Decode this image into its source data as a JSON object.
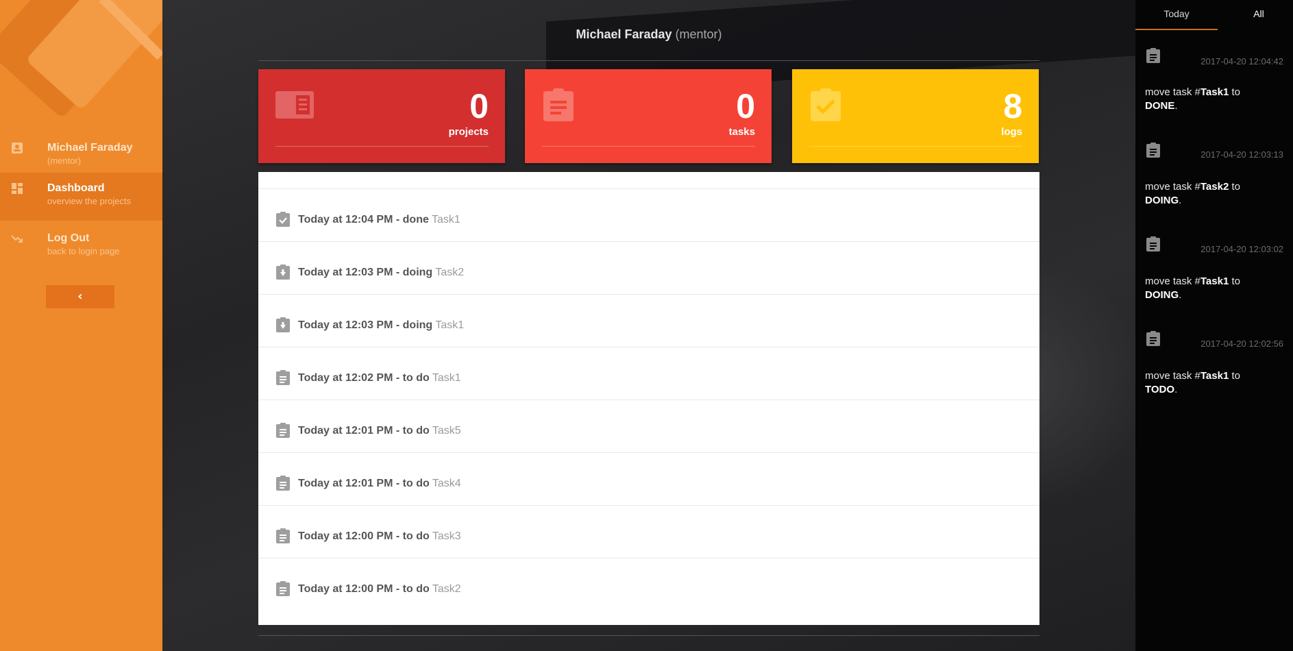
{
  "sidebar": {
    "user": {
      "name": "Michael Faraday",
      "role": "(mentor)"
    },
    "items": [
      {
        "title": "Dashboard",
        "subtitle": "overview the projects"
      },
      {
        "title": "Log Out",
        "subtitle": "back to login page"
      }
    ],
    "collapse_label": "‹"
  },
  "header": {
    "user_name": "Michael Faraday",
    "role": "(mentor)"
  },
  "cards": [
    {
      "count": "0",
      "label": "projects",
      "color": "#d32f2f",
      "icon": "projects-icon"
    },
    {
      "count": "0",
      "label": "tasks",
      "color": "#f44336",
      "icon": "clipboard-icon"
    },
    {
      "count": "8",
      "label": "logs",
      "color": "#ffc107",
      "icon": "clipboard-check-icon"
    }
  ],
  "logs": [
    {
      "when": "Today at 12:04 PM - ",
      "action": "done",
      "task": "Task1",
      "icon": "clipboard-check-icon"
    },
    {
      "when": "Today at 12:03 PM - ",
      "action": "doing",
      "task": "Task2",
      "icon": "clipboard-down-icon"
    },
    {
      "when": "Today at 12:03 PM - ",
      "action": "doing",
      "task": "Task1",
      "icon": "clipboard-down-icon"
    },
    {
      "when": "Today at 12:02 PM - ",
      "action": "to do",
      "task": "Task1",
      "icon": "clipboard-icon"
    },
    {
      "when": "Today at 12:01 PM - ",
      "action": "to do",
      "task": "Task5",
      "icon": "clipboard-icon"
    },
    {
      "when": "Today at 12:01 PM - ",
      "action": "to do",
      "task": "Task4",
      "icon": "clipboard-icon"
    },
    {
      "when": "Today at 12:00 PM - ",
      "action": "to do",
      "task": "Task3",
      "icon": "clipboard-icon"
    },
    {
      "when": "Today at 12:00 PM - ",
      "action": "to do",
      "task": "Task2",
      "icon": "clipboard-icon"
    }
  ],
  "right_panel": {
    "tabs": [
      "Today",
      "All"
    ],
    "active_tab": "Today",
    "activities": [
      {
        "time": "2017-04-20 12:04:42",
        "prefix": "move task #",
        "task": "Task1",
        "mid": " to ",
        "status": "DONE",
        "suffix": "."
      },
      {
        "time": "2017-04-20 12:03:13",
        "prefix": "move task #",
        "task": "Task2",
        "mid": " to ",
        "status": "DOING",
        "suffix": "."
      },
      {
        "time": "2017-04-20 12:03:02",
        "prefix": "move task #",
        "task": "Task1",
        "mid": " to ",
        "status": "DOING",
        "suffix": "."
      },
      {
        "time": "2017-04-20 12:02:56",
        "prefix": "move task #",
        "task": "Task1",
        "mid": " to ",
        "status": "TODO",
        "suffix": "."
      }
    ]
  },
  "colors": {
    "sidebar_bg": "#ee8a2c",
    "sidebar_active": "#e4791f",
    "right_panel_bg": "#050505",
    "tab_underline": "#c76f1c"
  }
}
